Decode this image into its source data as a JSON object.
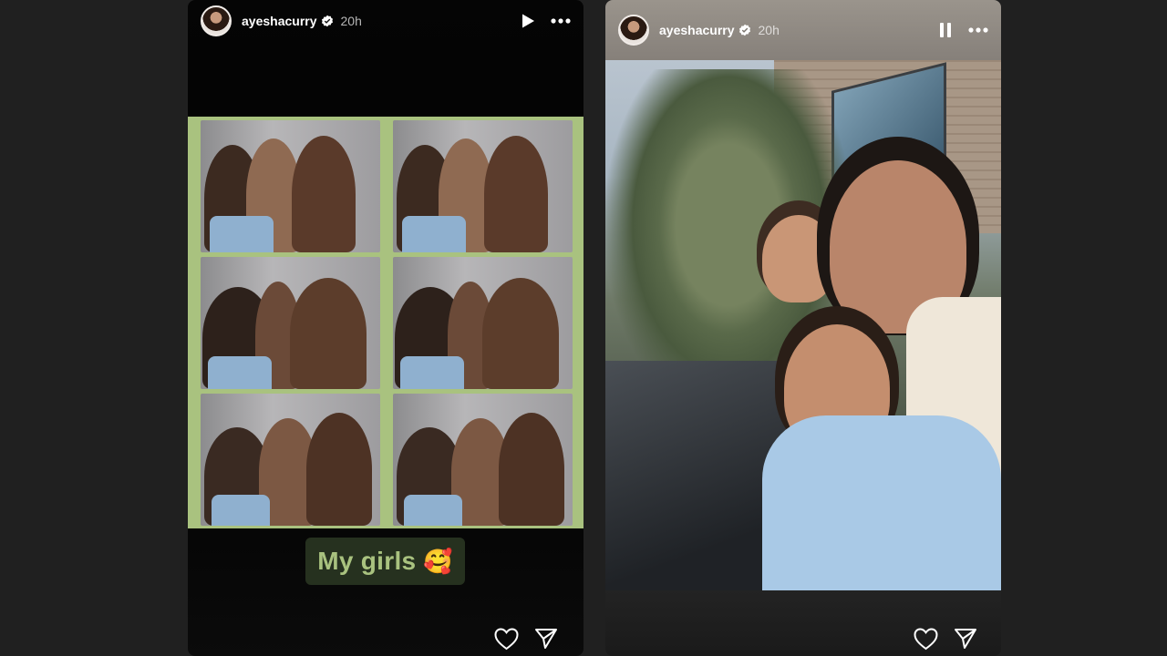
{
  "stories": [
    {
      "username": "ayeshacurry",
      "time": "20h",
      "playback_state": "paused",
      "control_icon": "play-icon",
      "more_icon": "more-icon",
      "caption": {
        "text": "My girls",
        "emoji": "🥰"
      },
      "photo_strip": {
        "count": 6,
        "frame_color": "#a9c27f"
      },
      "actions": {
        "like_icon": "heart-icon",
        "share_icon": "send-icon"
      }
    },
    {
      "username": "ayeshacurry",
      "time": "20h",
      "playback_state": "playing",
      "control_icon": "pause-icon",
      "more_icon": "more-icon",
      "actions": {
        "like_icon": "heart-icon",
        "share_icon": "send-icon"
      }
    }
  ],
  "colors": {
    "page_background": "#202020",
    "caption_background": "#26311f",
    "caption_text": "#a9c27f",
    "verified_badge": "#ffffff"
  }
}
